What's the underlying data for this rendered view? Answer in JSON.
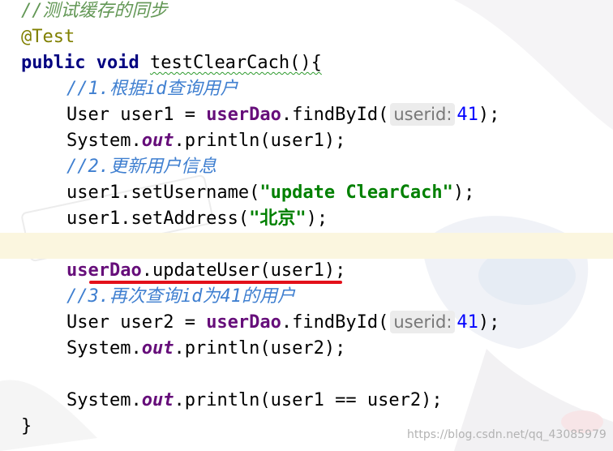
{
  "code": {
    "comment_sync": "//测试缓存的同步",
    "annotation": "@Test",
    "kw_public": "public",
    "kw_void": "void",
    "method_decl": "testClearCach(){",
    "comment_1": "//1.根据id查询用户",
    "user1_decl": "User user1 = ",
    "field_userdao": "userDao",
    "find_call": ".findById(",
    "hint_userid": "userid:",
    "num_41": "41",
    "close_paren_semi": ");",
    "system": "System.",
    "field_out": "out",
    "println_user1": ".println(user1);",
    "comment_2": "//2.更新用户信息",
    "set_username": "user1.setUsername(",
    "str_update": "\"update ClearCach\"",
    "set_address": "user1.setAddress(",
    "str_beijing": "\"北京\"",
    "update_call": ".updateUser(user1);",
    "comment_3": "//3.再次查询id为41的用户",
    "user2_decl": "User user2 = ",
    "println_user2": ".println(user2);",
    "println_compare": ".println(user1 == user2);",
    "close_brace": "}"
  },
  "watermark": "https://blog.csdn.net/qq_43085979",
  "colors": {
    "comment": "#629755",
    "keyword": "#000080",
    "field": "#660e7a",
    "string": "#008000",
    "number": "#0000ff",
    "annotation": "#808000",
    "caret_line": "#fbf6df",
    "red_underline": "#e3101a"
  }
}
